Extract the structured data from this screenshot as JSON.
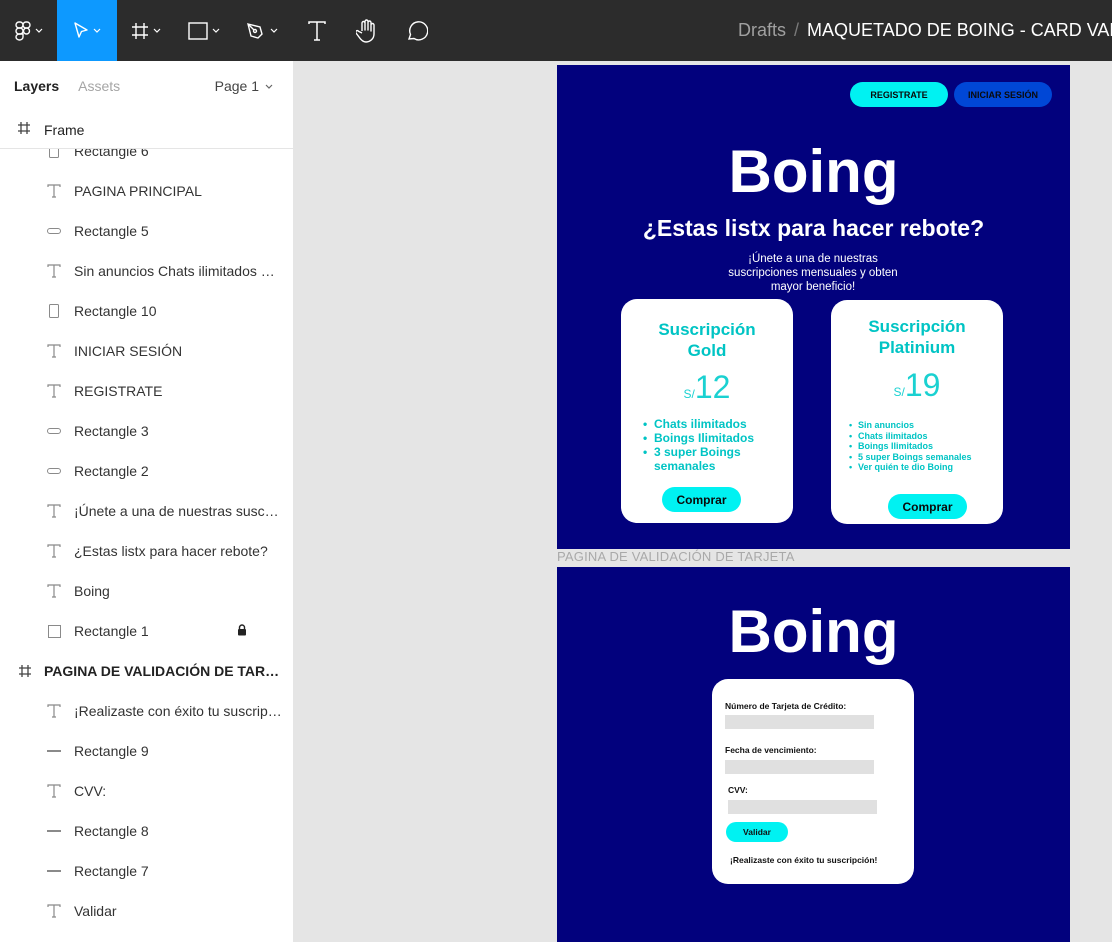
{
  "toolbar": {
    "tools": [
      {
        "name": "main-menu",
        "icon": "figma-logo-icon",
        "active": false
      },
      {
        "name": "move-tool",
        "icon": "cursor-arrow-icon",
        "active": true
      },
      {
        "name": "frame-tool",
        "icon": "frame-hash-icon",
        "active": false
      },
      {
        "name": "shape-tool",
        "icon": "rectangle-icon",
        "active": false
      },
      {
        "name": "pen-tool",
        "icon": "pen-icon",
        "active": false
      },
      {
        "name": "text-tool",
        "icon": "text-icon",
        "active": false
      },
      {
        "name": "hand-tool",
        "icon": "hand-icon",
        "active": false
      },
      {
        "name": "comment-tool",
        "icon": "comment-bubble-icon",
        "active": false
      }
    ],
    "breadcrumb": {
      "drafts": "Drafts",
      "separator": "/",
      "file": "MAQUETADO DE BOING - CARD VAL"
    }
  },
  "left_panel": {
    "tabs": {
      "layers": "Layers",
      "assets": "Assets"
    },
    "page_selector": "Page 1",
    "frame_header": "Frame",
    "layers": [
      {
        "label": "Rectangle 6",
        "icon": "rectangle-tall-icon",
        "type": "layer"
      },
      {
        "label": "PAGINA PRINCIPAL",
        "icon": "text-icon",
        "type": "layer"
      },
      {
        "label": "Rectangle 5",
        "icon": "rectangle-pill-icon",
        "type": "layer"
      },
      {
        "label": "Sin anuncios Chats ilimitados Boings Ilimitados 5 super Boings semanales Ver quién te dio Boing",
        "icon": "text-icon",
        "type": "layer"
      },
      {
        "label": "Rectangle 10",
        "icon": "rectangle-tall-icon",
        "type": "layer"
      },
      {
        "label": "INICIAR SESIÓN",
        "icon": "text-icon",
        "type": "layer"
      },
      {
        "label": "REGISTRATE",
        "icon": "text-icon",
        "type": "layer"
      },
      {
        "label": "Rectangle 3",
        "icon": "rectangle-pill-icon",
        "type": "layer"
      },
      {
        "label": "Rectangle 2",
        "icon": "rectangle-pill-icon",
        "type": "layer"
      },
      {
        "label": "¡Únete a una de nuestras suscripciones mensuales y obten mayor beneficio!",
        "icon": "text-icon",
        "type": "layer"
      },
      {
        "label": "¿Estas listx para hacer rebote?",
        "icon": "text-icon",
        "type": "layer"
      },
      {
        "label": "Boing",
        "icon": "text-icon",
        "type": "layer"
      },
      {
        "label": "Rectangle 1",
        "icon": "rectangle-square-icon",
        "type": "layer",
        "locked": true
      },
      {
        "label": "PAGINA DE VALIDACIÓN DE TARJETA",
        "icon": "frame-hash-icon",
        "type": "frame"
      },
      {
        "label": "¡Realizaste con éxito tu suscripción!",
        "icon": "text-icon",
        "type": "layer"
      },
      {
        "label": "Rectangle 9",
        "icon": "line-icon",
        "type": "layer"
      },
      {
        "label": "CVV:",
        "icon": "text-icon",
        "type": "layer"
      },
      {
        "label": "Rectangle 8",
        "icon": "line-icon",
        "type": "layer"
      },
      {
        "label": "Rectangle 7",
        "icon": "line-icon",
        "type": "layer"
      },
      {
        "label": "Validar",
        "icon": "text-icon",
        "type": "layer"
      }
    ]
  },
  "canvas": {
    "artboard_label": "PAGINA DE VALIDACIÓN DE TARJETA",
    "main": {
      "register_button": "REGISTRATE",
      "login_button": "INICIAR SESIÓN",
      "brand": "Boing",
      "headline": "¿Estas listx para hacer rebote?",
      "subtitle": "¡Únete a una de nuestras suscripciones mensuales y obten mayor beneficio!",
      "plans": [
        {
          "title_line1": "Suscripción",
          "title_line2": "Gold",
          "currency": "S/",
          "price": "12",
          "features": [
            "Chats ilimitados",
            "Boings Ilimitados",
            "3 super Boings semanales"
          ],
          "buy_label": "Comprar"
        },
        {
          "title_line1": "Suscripción",
          "title_line2": "Platinium",
          "currency": "S/",
          "price": "19",
          "features": [
            "Sin anuncios",
            "Chats ilimitados",
            "Boings Ilimitados",
            "5 super Boings  semanales",
            "Ver quién te dio Boing"
          ],
          "buy_label": "Comprar"
        }
      ]
    },
    "validation": {
      "brand": "Boing",
      "card_number_label": "Número de Tarjeta de Crédito:",
      "expiry_label": "Fecha de vencimiento:",
      "cvv_label": "CVV:",
      "validate_button": "Validar",
      "success_message": "¡Realizaste con éxito tu suscripción!"
    }
  },
  "colors": {
    "toolbar_bg": "#2c2c2c",
    "active_tool": "#0d99ff",
    "artboard_bg": "#02017d",
    "cyan_button": "#00f2f2",
    "blue_button": "#0047d6",
    "card_accent": "#00c4c4"
  }
}
